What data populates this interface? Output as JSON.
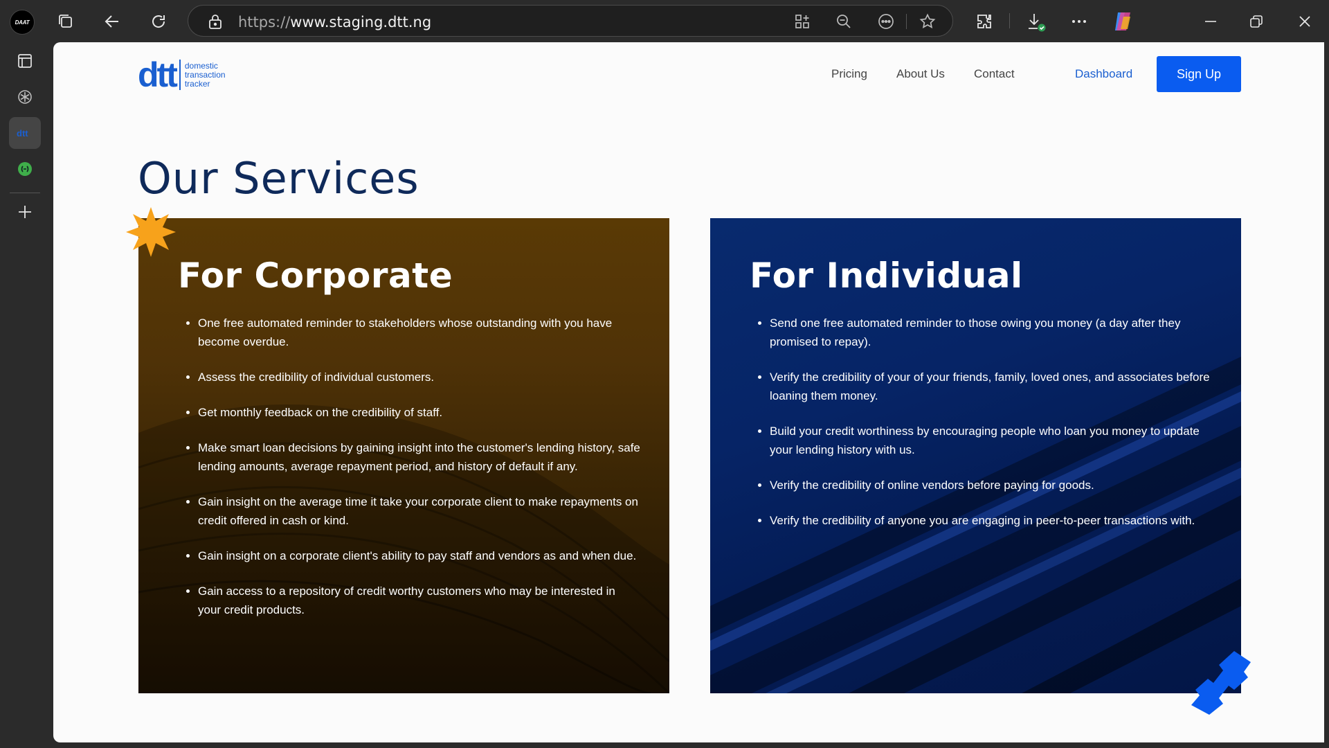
{
  "browser": {
    "profile_label": "DAAT",
    "url_scheme": "https://",
    "url_domain": "www.staging.dtt.ng",
    "icons": [
      "workspaces-icon",
      "back-icon",
      "refresh-icon",
      "lock-icon",
      "apps-icon",
      "zoom-out-icon",
      "reader-icon",
      "favorite-icon",
      "extensions-icon",
      "downloads-icon",
      "more-icon",
      "copilot-icon",
      "minimize-icon",
      "restore-icon",
      "close-icon"
    ]
  },
  "sidebar": {
    "items": [
      "tab-panel-icon",
      "chatgpt-icon",
      "dtt-tab-icon",
      "app-icon",
      "add-icon"
    ]
  },
  "site": {
    "logo_mark": "dtt",
    "logo_lines": [
      "domestic",
      "transaction",
      "tracker"
    ],
    "nav": {
      "pricing": "Pricing",
      "about": "About Us",
      "contact": "Contact",
      "dashboard": "Dashboard",
      "signup": "Sign Up"
    },
    "page_title": "Our Services",
    "corporate": {
      "title": "For Corporate",
      "items": [
        "One free automated reminder to stakeholders whose outstanding with you have become overdue.",
        "Assess the credibility of individual customers.",
        "Get monthly feedback on the credibility of staff.",
        "Make smart loan decisions by gaining insight into the customer's lending history, safe lending amounts, average repayment period, and history of default if any.",
        "Gain insight on the average time it take your corporate client to make repayments on credit offered in cash or kind.",
        "Gain insight on a corporate client's ability to pay staff and vendors as and when due.",
        "Gain access to a repository of credit worthy customers who may be interested in your credit products."
      ]
    },
    "individual": {
      "title": "For Individual",
      "items": [
        "Send one free automated reminder to those owing you money (a day after they promised to repay).",
        "Verify the credibility of your of your friends, family, loved ones, and associates before loaning them money.",
        "Build your credit worthiness by encouraging people who loan you money to update your lending history with us.",
        "Verify the credibility of online vendors before paying for goods.",
        "Verify the credibility of anyone you are engaging in peer-to-peer transactions with."
      ]
    }
  },
  "colors": {
    "brand_blue": "#0a5cf0",
    "title_navy": "#0f2a5a",
    "corporate_card": "#4f3207",
    "individual_card": "#062466",
    "accent_star": "#f7a21b"
  }
}
